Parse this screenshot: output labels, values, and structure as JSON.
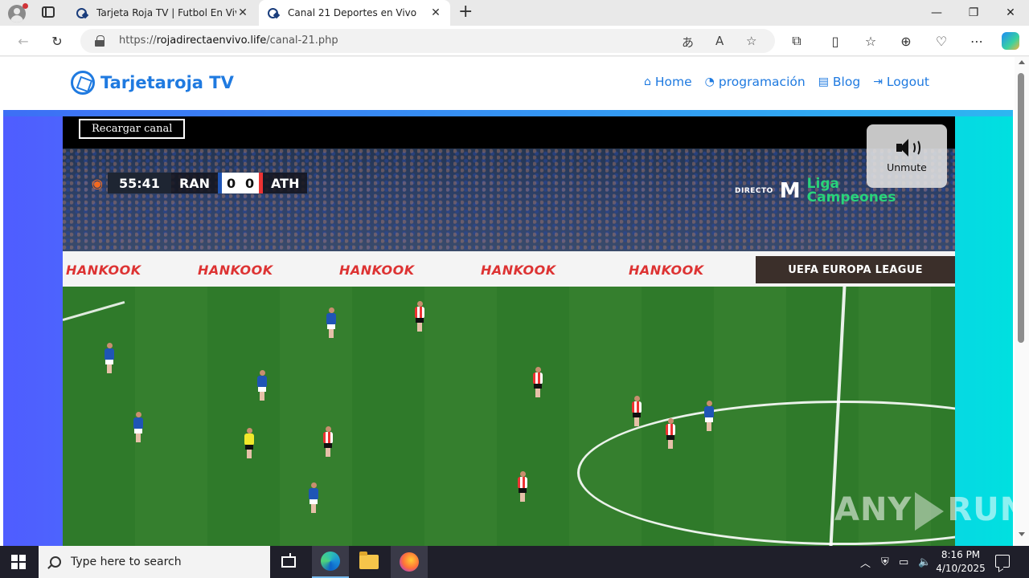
{
  "browser": {
    "tabs": [
      {
        "title": "Tarjeta Roja TV | Futbol En Vivo - Ta",
        "active": false
      },
      {
        "title": "Canal 21 Deportes en Vivo",
        "active": true
      }
    ],
    "url": {
      "prefix": "https://",
      "host": "rojadirectaenvivo.life",
      "path": "/canal-21.php"
    }
  },
  "site": {
    "logo_text": "Tarjetaroja TV",
    "nav": [
      {
        "label": "Home",
        "icon": "home-icon"
      },
      {
        "label": "programación",
        "icon": "tachometer-icon"
      },
      {
        "label": "Blog",
        "icon": "newspaper-icon"
      },
      {
        "label": "Logout",
        "icon": "sign-out-icon"
      }
    ],
    "accent": "#1f7ae0"
  },
  "player": {
    "reload_label": "Recargar canal",
    "unmute_label": "Unmute",
    "scorebug": {
      "time": "55:41",
      "home": "RAN",
      "home_score": "0",
      "away_score": "0",
      "away": "ATH"
    },
    "broadcaster": {
      "directo": "DIRECTO",
      "channel_mark": "M",
      "liga_line1": "Liga",
      "liga_line2": "Campeones"
    },
    "boards": {
      "sponsor": "HANKOOK",
      "league": "UEFA EUROPA LEAGUE"
    },
    "watermark": {
      "left": "ANY",
      "right": "RUN"
    }
  },
  "taskbar": {
    "search_placeholder": "Type here to search",
    "time": "8:16 PM",
    "date": "4/10/2025"
  }
}
